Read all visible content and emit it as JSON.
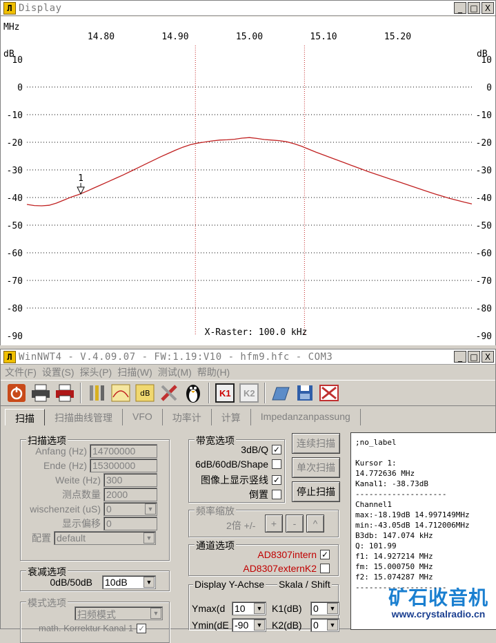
{
  "display_window": {
    "title": "Display",
    "icon": "app-logo-icon",
    "buttons": {
      "minimize": "_",
      "maximize": "□",
      "close": "X"
    }
  },
  "chart_data": {
    "type": "line",
    "x_unit_label": "MHz",
    "y_unit_label": "dB",
    "x_tick_labels": [
      "14.80",
      "14.90",
      "15.00",
      "15.10",
      "15.20"
    ],
    "x_ticks": [
      14.8,
      14.9,
      15.0,
      15.1,
      15.2
    ],
    "xlim": [
      14.7,
      15.3
    ],
    "ylim": [
      -90,
      10
    ],
    "y_ticks": [
      10,
      0,
      -10,
      -20,
      -30,
      -40,
      -50,
      -60,
      -70,
      -80,
      -90
    ],
    "y_tick_labels": [
      "10",
      "0",
      "-10",
      "-20",
      "-30",
      "-40",
      "-50",
      "-60",
      "-70",
      "-80",
      "-90"
    ],
    "vertical_markers": [
      14.927214,
      15.074287
    ],
    "cursor": {
      "label": "1",
      "x": 14.772636,
      "y": -38.73
    },
    "x_raster_label": "X-Raster: 100.0 kHz",
    "grid": "dotted-horizontal",
    "series_color": "#c02020",
    "x": [
      14.7,
      14.71,
      14.72,
      14.73,
      14.74,
      14.75,
      14.76,
      14.77,
      14.78,
      14.79,
      14.8,
      14.81,
      14.82,
      14.83,
      14.84,
      14.85,
      14.86,
      14.87,
      14.88,
      14.89,
      14.9,
      14.91,
      14.92,
      14.93,
      14.94,
      14.95,
      14.96,
      14.97,
      14.98,
      14.99,
      15.0,
      15.01,
      15.02,
      15.03,
      15.04,
      15.05,
      15.06,
      15.07,
      15.08,
      15.09,
      15.1,
      15.11,
      15.12,
      15.13,
      15.14,
      15.15,
      15.16,
      15.17,
      15.18,
      15.19,
      15.2,
      15.21,
      15.22,
      15.23,
      15.24,
      15.25,
      15.26,
      15.27,
      15.28,
      15.29,
      15.3
    ],
    "y": [
      -42.5,
      -42.9,
      -43.0,
      -42.8,
      -42.0,
      -40.9,
      -39.8,
      -38.9,
      -37.8,
      -36.6,
      -35.4,
      -34.2,
      -33.0,
      -31.8,
      -30.5,
      -29.2,
      -27.9,
      -26.6,
      -25.3,
      -24.1,
      -22.9,
      -21.8,
      -20.9,
      -20.3,
      -19.9,
      -19.5,
      -19.2,
      -19.1,
      -18.9,
      -18.5,
      -18.3,
      -18.6,
      -19.0,
      -19.2,
      -19.4,
      -19.8,
      -20.5,
      -21.4,
      -22.5,
      -23.6,
      -24.6,
      -25.6,
      -26.6,
      -27.6,
      -28.6,
      -29.6,
      -30.6,
      -31.5,
      -32.4,
      -33.3,
      -34.2,
      -35.1,
      -36.0,
      -36.9,
      -37.8,
      -38.7,
      -39.5,
      -40.3,
      -41.0,
      -41.7,
      -42.3
    ]
  },
  "main_window": {
    "title": "WinNWT4 - V.4.09.07 - FW:1.19:V10 - hfm9.hfc - COM3",
    "icon": "app-logo-icon",
    "menu": [
      "文件(F)",
      "设置(S)",
      "探头(P)",
      "扫描(W)",
      "测试(M)",
      "帮助(H)"
    ],
    "toolbar_icons": [
      "power-icon",
      "printer-icon",
      "printer-color-icon",
      "tools-icon",
      "sweep-curve-icon",
      "db-icon",
      "wrench-icon",
      "penguin-icon",
      "k1-icon",
      "k2-icon",
      "folder-open-icon",
      "save-icon",
      "delete-icon"
    ],
    "toolbar_text": {
      "k1": "K1",
      "k2": "K2",
      "db": "dB"
    },
    "tabs": [
      "扫描",
      "扫描曲线管理",
      "VFO",
      "功率计",
      "计算",
      "Impedanzanpassung"
    ]
  },
  "scan_options": {
    "title": "扫描选项",
    "start_label": "Anfang (Hz)",
    "start_value": "14700000",
    "end_label": "Ende (Hz)",
    "end_value": "15300000",
    "width_label": "Weite (Hz)",
    "width_value": "300",
    "points_label": "测点数量",
    "points_value": "2000",
    "wait_label": "wischenzeit (uS)",
    "wait_value": "0",
    "offset_label": "显示偏移",
    "offset_value": "0",
    "config_label": "配置",
    "config_value": "default"
  },
  "attenuation": {
    "title": "衰减选项",
    "label": "0dB/50dB",
    "value": "10dB"
  },
  "mode_options": {
    "title": "模式选项",
    "mode_value": "扫频模式",
    "math_label": "math. Korrektur Kanal 1"
  },
  "bandwidth": {
    "title": "带宽选项",
    "opt1": "3dB/Q",
    "opt1_checked": "✓",
    "opt2": "6dB/60dB/Shape",
    "opt2_checked": "",
    "opt3": "图像上显示竖线",
    "opt3_checked": "✓",
    "opt4": "倒置",
    "opt4_checked": ""
  },
  "freq_zoom": {
    "title": "频率缩放",
    "label": "2倍 +/-",
    "plus": "+",
    "minus": "-",
    "up": "^"
  },
  "channel": {
    "title": "通道选项",
    "ch1": "AD8307intern",
    "ch1_checked": "✓",
    "ch2": "AD8307externK2",
    "ch2_checked": ""
  },
  "display_y": {
    "title_left": "Display Y-Achse",
    "title_right": "Skala / Shift",
    "ymax_label": "Ymax(d",
    "ymax_value": "10",
    "ymin_label": "Ymin(dE",
    "ymin_value": "-90",
    "k1_label": "K1(dB)",
    "k1_value": "0",
    "k2_label": "K2(dB)",
    "k2_value": "0"
  },
  "buttons": {
    "continuous": "连续扫描",
    "single": "单次扫描",
    "stop": "停止扫描"
  },
  "info_lines": [
    ";no_label",
    "",
    "Kursor 1:",
    "14.772636 MHz",
    "Kanal1: -38.73dB",
    "--------------------",
    "Channel1",
    "max:-18.19dB 14.997149MHz",
    "min:-43.05dB 14.712006MHz",
    "B3db: 147.074 kHz",
    "Q: 101.99",
    "f1: 14.927214 MHz",
    "fm: 15.000750 MHz",
    "f2: 15.074287 MHz",
    "--------------------"
  ],
  "watermark": {
    "line1": "矿石收音机",
    "line2": "www.crystalradio.cn"
  }
}
